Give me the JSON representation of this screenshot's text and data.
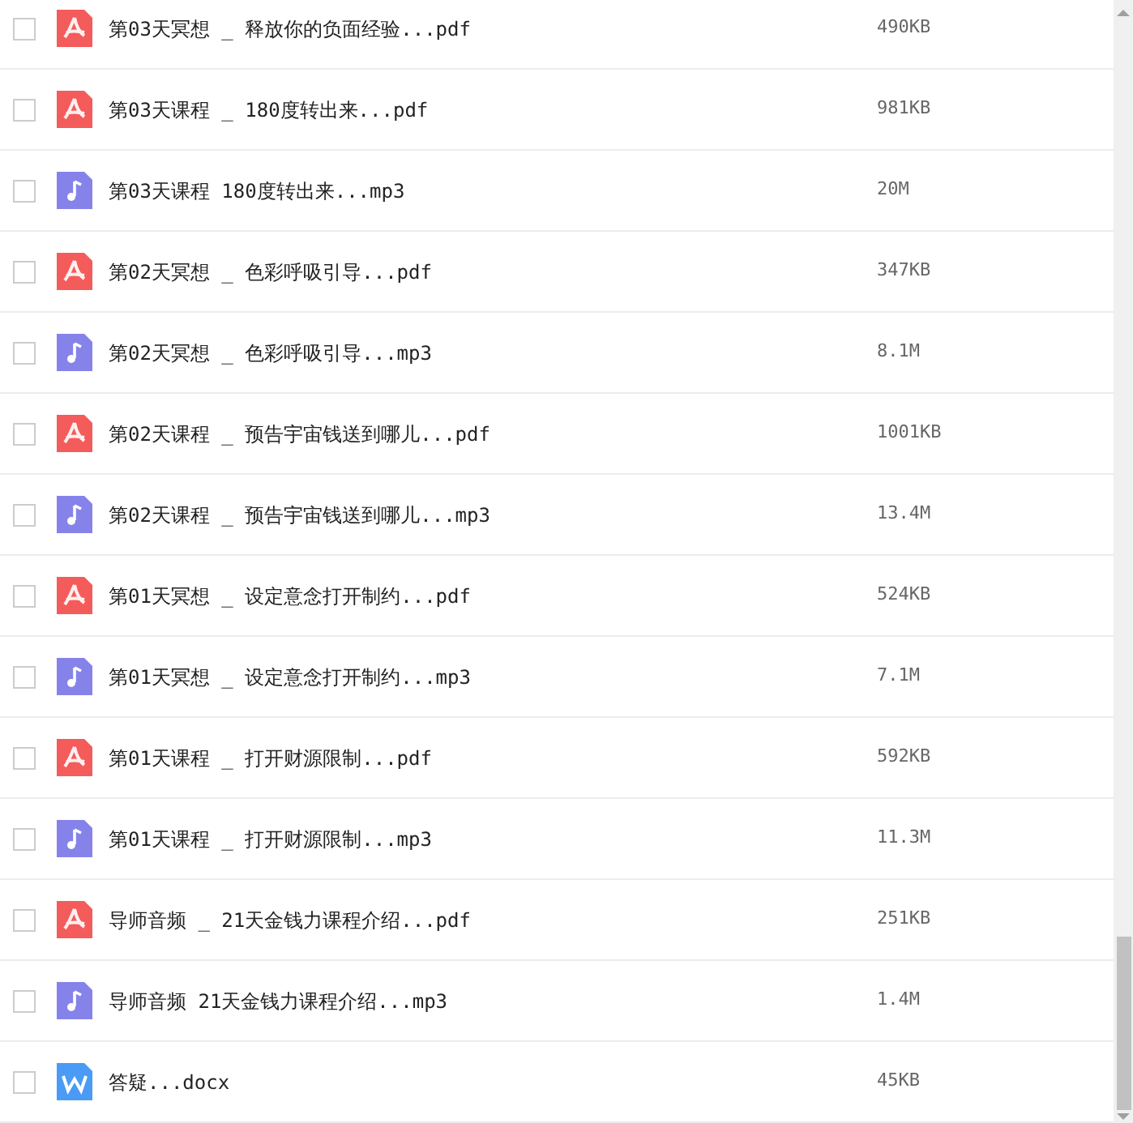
{
  "files": [
    {
      "name": "第03天冥想 _ 释放你的负面经验...pdf",
      "kind": "pdf",
      "size": "490KB",
      "checked": false
    },
    {
      "name": "第03天课程 _ 180度转出来...pdf",
      "kind": "pdf",
      "size": "981KB",
      "checked": false
    },
    {
      "name": "第03天课程 180度转出来...mp3",
      "kind": "mp3",
      "size": "20M",
      "checked": false
    },
    {
      "name": "第02天冥想 _ 色彩呼吸引导...pdf",
      "kind": "pdf",
      "size": "347KB",
      "checked": false
    },
    {
      "name": "第02天冥想 _ 色彩呼吸引导...mp3",
      "kind": "mp3",
      "size": "8.1M",
      "checked": false
    },
    {
      "name": "第02天课程 _ 预告宇宙钱送到哪儿...pdf",
      "kind": "pdf",
      "size": "1001KB",
      "checked": false
    },
    {
      "name": "第02天课程 _ 预告宇宙钱送到哪儿...mp3",
      "kind": "mp3",
      "size": "13.4M",
      "checked": false
    },
    {
      "name": "第01天冥想 _ 设定意念打开制约...pdf",
      "kind": "pdf",
      "size": "524KB",
      "checked": false
    },
    {
      "name": "第01天冥想 _ 设定意念打开制约...mp3",
      "kind": "mp3",
      "size": "7.1M",
      "checked": false
    },
    {
      "name": "第01天课程 _ 打开财源限制...pdf",
      "kind": "pdf",
      "size": "592KB",
      "checked": false
    },
    {
      "name": "第01天课程 _ 打开财源限制...mp3",
      "kind": "mp3",
      "size": "11.3M",
      "checked": false
    },
    {
      "name": "导师音频 _ 21天金钱力课程介绍...pdf",
      "kind": "pdf",
      "size": "251KB",
      "checked": false
    },
    {
      "name": "导师音频 21天金钱力课程介绍...mp3",
      "kind": "mp3",
      "size": "1.4M",
      "checked": false
    },
    {
      "name": "答疑...docx",
      "kind": "docx",
      "size": "45KB",
      "checked": false
    }
  ]
}
